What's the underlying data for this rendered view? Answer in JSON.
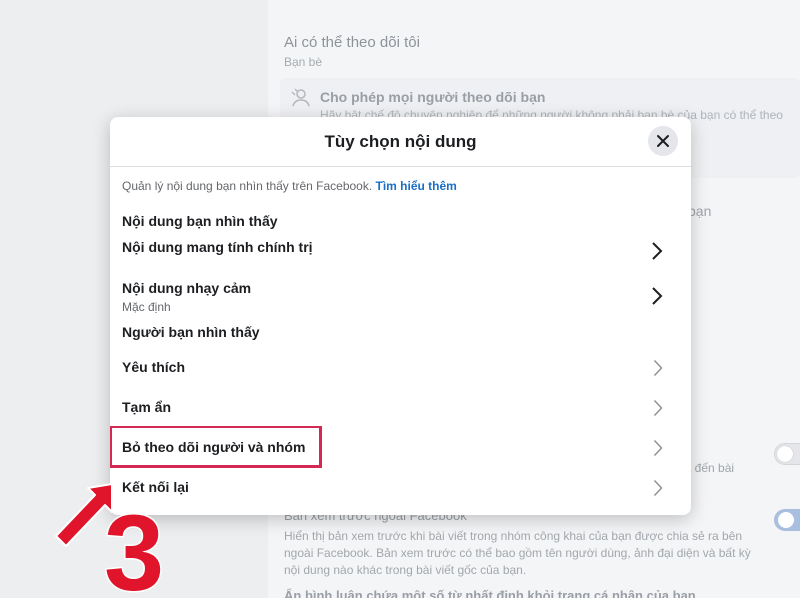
{
  "background": {
    "follow_title": "Ai có thể theo dõi tôi",
    "follow_sub": "Bạn bè",
    "allow_title": "Cho phép mọi người theo dõi bạn",
    "allow_sub": "Hãy bật chế độ chuyên nghiệp để những người không phải bạn bè của bạn có thể theo",
    "right_fragment": "bạn",
    "right_fragment_2": "t đến bài",
    "preview_title": "Bản xem trước ngoài Facebook",
    "preview_body": "Hiển thị bản xem trước khi bài viết trong nhóm công khai của bạn được chia sẻ ra bên ngoài Facebook. Bản xem trước có thể bao gồm tên người dùng, ảnh đại diện và bất kỳ nội dung nào khác trong bài viết gốc của bạn.",
    "bottom_text": "Ẩn bình luận chứa một số từ nhất định khỏi trang cá nhân của bạn"
  },
  "modal": {
    "title": "Tùy chọn nội dung",
    "description": "Quản lý nội dung bạn nhìn thấy trên Facebook.",
    "learn_more": "Tìm hiểu thêm",
    "section_content": "Nội dung bạn nhìn thấy",
    "item_political": "Nội dung mang tính chính trị",
    "item_sensitive": "Nội dung nhạy cảm",
    "item_sensitive_sub": "Mặc định",
    "section_people": "Người bạn nhìn thấy",
    "item_favorites": "Yêu thích",
    "item_snooze": "Tạm ẩn",
    "item_unfollow": "Bỏ theo dõi người và nhóm",
    "item_reconnect": "Kết nối lại"
  },
  "annotation": {
    "step_number": "3"
  },
  "colors": {
    "highlight": "#d32a54",
    "annotation_red": "#e0142a",
    "link": "#1a6ec6"
  }
}
